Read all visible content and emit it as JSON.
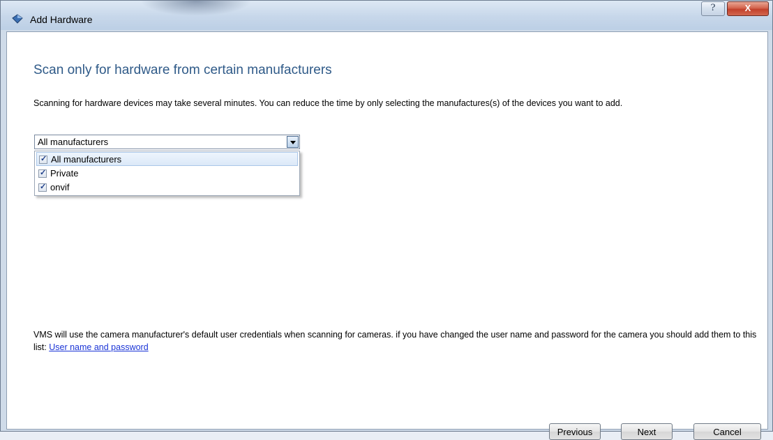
{
  "window": {
    "title": "Add Hardware",
    "help_label": "?",
    "close_label": "X"
  },
  "main": {
    "heading": "Scan only for hardware from certain manufacturers",
    "description": "Scanning for hardware devices may take several minutes. You can reduce the time by only selecting the manufactures(s) of the devices you want to add.",
    "combo": {
      "selected": "All manufacturers",
      "options": [
        {
          "label": "All manufacturers",
          "checked": true,
          "highlighted": true
        },
        {
          "label": "Private",
          "checked": true,
          "highlighted": false
        },
        {
          "label": "onvif",
          "checked": true,
          "highlighted": false
        }
      ]
    },
    "info_text": "VMS will use the camera manufacturer's default user credentials when scanning for cameras. if you have changed the user name and password for the camera you should add them to this list: ",
    "info_link": "User name and password"
  },
  "footer": {
    "previous_label": "Previous",
    "next_label": "Next",
    "cancel_label": "Cancel"
  },
  "icons": {
    "app_icon": "app-diamond-icon",
    "check_glyph": "✓"
  },
  "colors": {
    "heading": "#2f5a88",
    "link": "#1a34d6",
    "close_button": "#c2412c"
  }
}
